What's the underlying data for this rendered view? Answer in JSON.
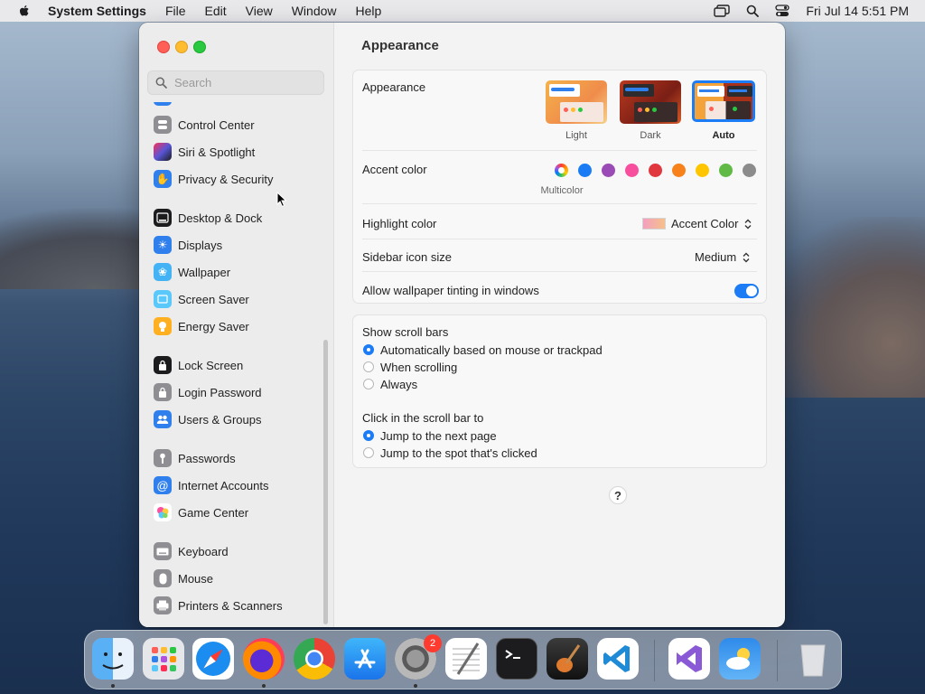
{
  "menubar": {
    "app_name": "System Settings",
    "items": [
      "File",
      "Edit",
      "View",
      "Window",
      "Help"
    ],
    "clock": "Fri Jul 14  5:51 PM"
  },
  "sidebar": {
    "search_placeholder": "Search",
    "items": [
      {
        "label": "Control Center",
        "icon": "control-center-icon",
        "color": "#8e8e93"
      },
      {
        "label": "Siri & Spotlight",
        "icon": "siri-icon",
        "color": "#b84ad8"
      },
      {
        "label": "Privacy & Security",
        "icon": "hand-icon",
        "color": "#2f80ed"
      },
      {
        "label": "Desktop & Dock",
        "icon": "dock-icon",
        "color": "#1c1c1e"
      },
      {
        "label": "Displays",
        "icon": "sun-icon",
        "color": "#2f80ed"
      },
      {
        "label": "Wallpaper",
        "icon": "flower-icon",
        "color": "#43b3f5"
      },
      {
        "label": "Screen Saver",
        "icon": "screen-saver-icon",
        "color": "#5ac8fa"
      },
      {
        "label": "Energy Saver",
        "icon": "bulb-icon",
        "color": "#ffb020"
      },
      {
        "label": "Lock Screen",
        "icon": "lock-icon",
        "color": "#1c1c1e"
      },
      {
        "label": "Login Password",
        "icon": "lock-icon",
        "color": "#8e8e93"
      },
      {
        "label": "Users & Groups",
        "icon": "users-icon",
        "color": "#2f80ed"
      },
      {
        "label": "Passwords",
        "icon": "key-icon",
        "color": "#8e8e93"
      },
      {
        "label": "Internet Accounts",
        "icon": "at-icon",
        "color": "#2f80ed"
      },
      {
        "label": "Game Center",
        "icon": "game-center-icon",
        "color": "#ffffff"
      },
      {
        "label": "Keyboard",
        "icon": "keyboard-icon",
        "color": "#8e8e93"
      },
      {
        "label": "Mouse",
        "icon": "mouse-icon",
        "color": "#8e8e93"
      },
      {
        "label": "Printers & Scanners",
        "icon": "printer-icon",
        "color": "#8e8e93"
      }
    ]
  },
  "content": {
    "title": "Appearance",
    "appearance": {
      "label": "Appearance",
      "options": [
        {
          "label": "Light",
          "selected": false
        },
        {
          "label": "Dark",
          "selected": false
        },
        {
          "label": "Auto",
          "selected": true
        }
      ]
    },
    "accent": {
      "label": "Accent color",
      "selected_name": "Multicolor",
      "colors": [
        "#ff6b6b",
        "#1a7cf5",
        "#9a4bb5",
        "#f74f9e",
        "#e0383e",
        "#f7821b",
        "#ffc600",
        "#62ba46",
        "#8c8c8c"
      ]
    },
    "highlight": {
      "label": "Highlight color",
      "value": "Accent Color"
    },
    "sidebar_icon": {
      "label": "Sidebar icon size",
      "value": "Medium"
    },
    "tinting": {
      "label": "Allow wallpaper tinting in windows",
      "on": true
    },
    "scroll_bars": {
      "label": "Show scroll bars",
      "options": [
        {
          "label": "Automatically based on mouse or trackpad",
          "selected": true
        },
        {
          "label": "When scrolling",
          "selected": false
        },
        {
          "label": "Always",
          "selected": false
        }
      ]
    },
    "click_scroll": {
      "label": "Click in the scroll bar to",
      "options": [
        {
          "label": "Jump to the next page",
          "selected": true
        },
        {
          "label": "Jump to the spot that's clicked",
          "selected": false
        }
      ]
    },
    "help": "?"
  },
  "dock": {
    "system_settings_badge": "2",
    "apps": [
      "finder-icon",
      "launchpad-icon",
      "safari-icon",
      "firefox-icon",
      "chrome-icon",
      "app-store-icon",
      "system-settings-icon",
      "textedit-icon",
      "terminal-icon",
      "garageband-icon",
      "vscode-icon",
      "visual-studio-icon",
      "weather-icon",
      "trash-icon"
    ]
  }
}
